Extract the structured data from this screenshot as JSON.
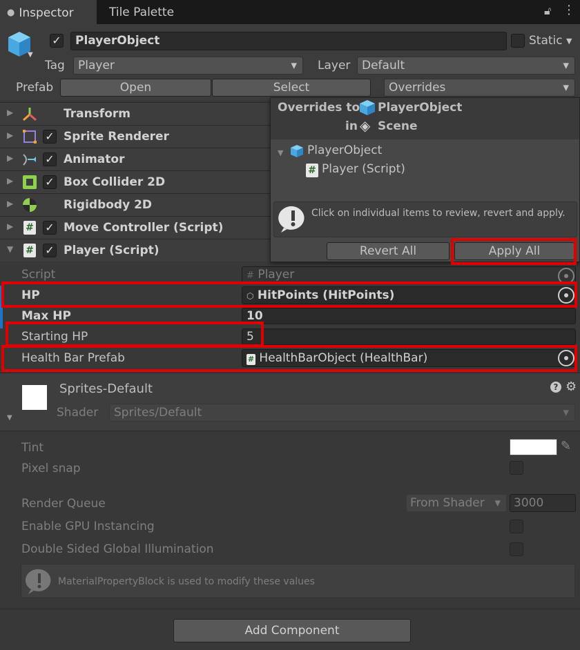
{
  "tabs": {
    "inspector": "Inspector",
    "tile_palette": "Tile Palette"
  },
  "header": {
    "object_name": "PlayerObject",
    "static_label": "Static",
    "tag_label": "Tag",
    "tag_value": "Player",
    "layer_label": "Layer",
    "layer_value": "Default",
    "prefab_label": "Prefab",
    "open_label": "Open",
    "select_label": "Select",
    "overrides_label": "Overrides"
  },
  "components": [
    {
      "label": "Transform"
    },
    {
      "label": "Sprite Renderer"
    },
    {
      "label": "Animator"
    },
    {
      "label": "Box Collider 2D"
    },
    {
      "label": "Rigidbody 2D"
    },
    {
      "label": "Move Controller (Script)"
    },
    {
      "label": "Player (Script)"
    }
  ],
  "overrides_popup": {
    "title_prefix": "Overrides to",
    "title_object": "PlayerObject",
    "title_in": "in",
    "title_scene": "Scene",
    "tree_root": "PlayerObject",
    "tree_child": "Player (Script)",
    "info_text": "Click on individual items to review, revert and apply.",
    "revert_all": "Revert All",
    "apply_all": "Apply All"
  },
  "player_fields": {
    "script_label": "Script",
    "script_value": "Player",
    "hp_label": "HP",
    "hp_value": "HitPoints (HitPoints)",
    "maxhp_label": "Max HP",
    "maxhp_value": "10",
    "starthp_label": "Starting HP",
    "starthp_value": "5",
    "healthbar_label": "Health Bar Prefab",
    "healthbar_value": "HealthBarObject (HealthBar)"
  },
  "material": {
    "name": "Sprites-Default",
    "shader_label": "Shader",
    "shader_value": "Sprites/Default",
    "tint_label": "Tint",
    "pixel_snap_label": "Pixel snap",
    "render_queue_label": "Render Queue",
    "render_queue_mode": "From Shader",
    "render_queue_value": "3000",
    "gpu_label": "Enable GPU Instancing",
    "dsgi_label": "Double Sided Global Illumination",
    "info_text": "MaterialPropertyBlock is used to modify these values"
  },
  "add_component": "Add Component",
  "colors": {
    "highlight_red": "#e00000",
    "panel": "#383838",
    "popup": "#474747"
  }
}
